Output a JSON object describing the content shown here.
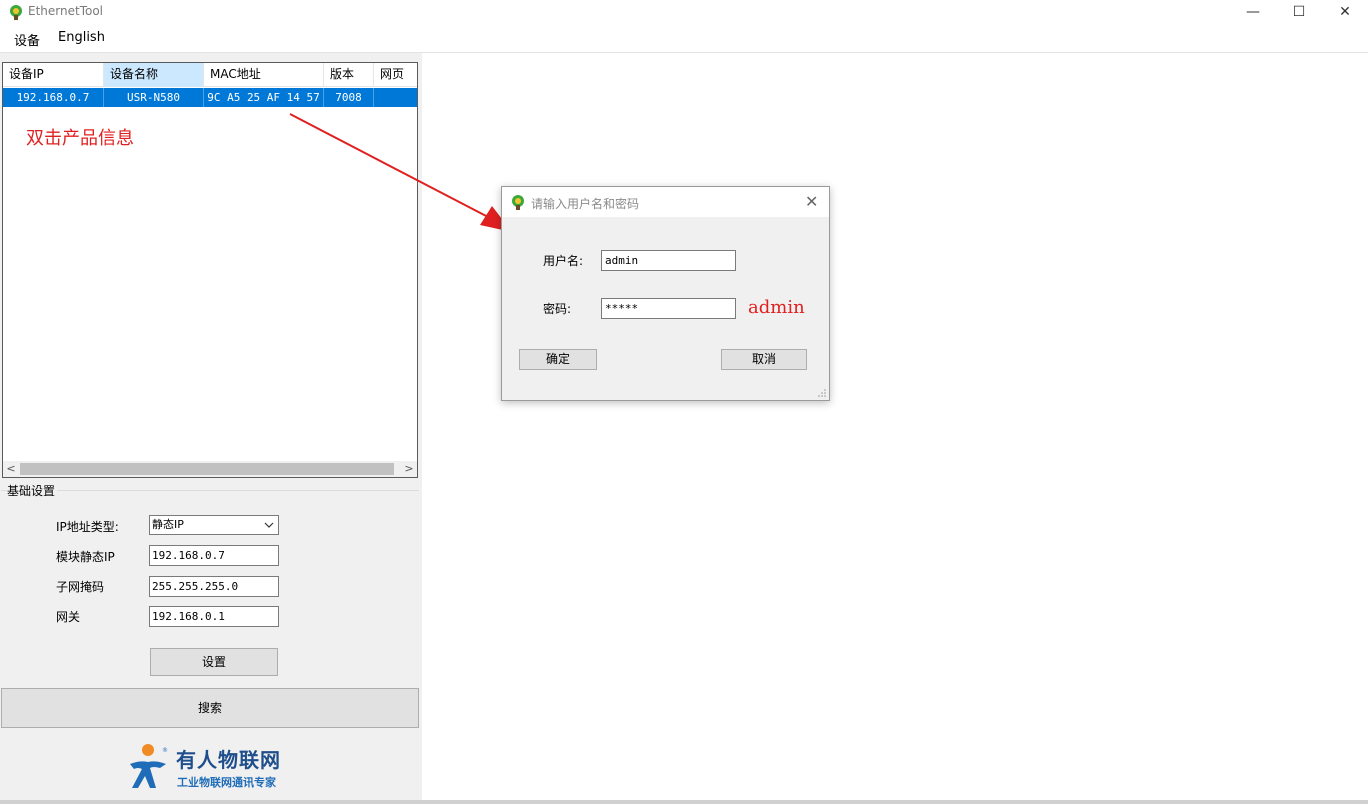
{
  "window": {
    "title": "EthernetTool",
    "min_glyph": "—",
    "max_glyph": "☐",
    "close_glyph": "✕"
  },
  "menu": {
    "items": [
      "设备",
      "English"
    ]
  },
  "device_list": {
    "columns": [
      "设备IP",
      "设备名称",
      "MAC地址",
      "版本",
      "网页"
    ],
    "rows": [
      {
        "ip": "192.168.0.7",
        "name": "USR-N580",
        "mac": "9C A5 25 AF 14 57",
        "version": "7008",
        "web": ""
      }
    ],
    "annotation": "双击产品信息",
    "scroll_left": "<",
    "scroll_right": ">"
  },
  "basic_settings": {
    "title": "基础设置",
    "ip_type_label": "IP地址类型:",
    "ip_type_value": "静态IP",
    "static_ip_label": "模块静态IP",
    "static_ip_value": "192.168.0.7",
    "subnet_label": "子网掩码",
    "subnet_value": "255.255.255.0",
    "gateway_label": "网关",
    "gateway_value": "192.168.0.1",
    "set_button": "设置"
  },
  "search_button": "搜索",
  "logo": {
    "name": "有人物联网",
    "tagline": "工业物联网通讯专家"
  },
  "login_dialog": {
    "title": "请输入用户名和密码",
    "close_glyph": "✕",
    "username_label": "用户名:",
    "username_value": "admin",
    "password_label": "密码:",
    "password_value": "*****",
    "password_hint": "admin",
    "ok_button": "确定",
    "cancel_button": "取消"
  },
  "colors": {
    "selection": "#0078d7",
    "annotation": "#e02020",
    "brand_blue": "#1f4e8c",
    "brand_orange": "#f08a24"
  }
}
